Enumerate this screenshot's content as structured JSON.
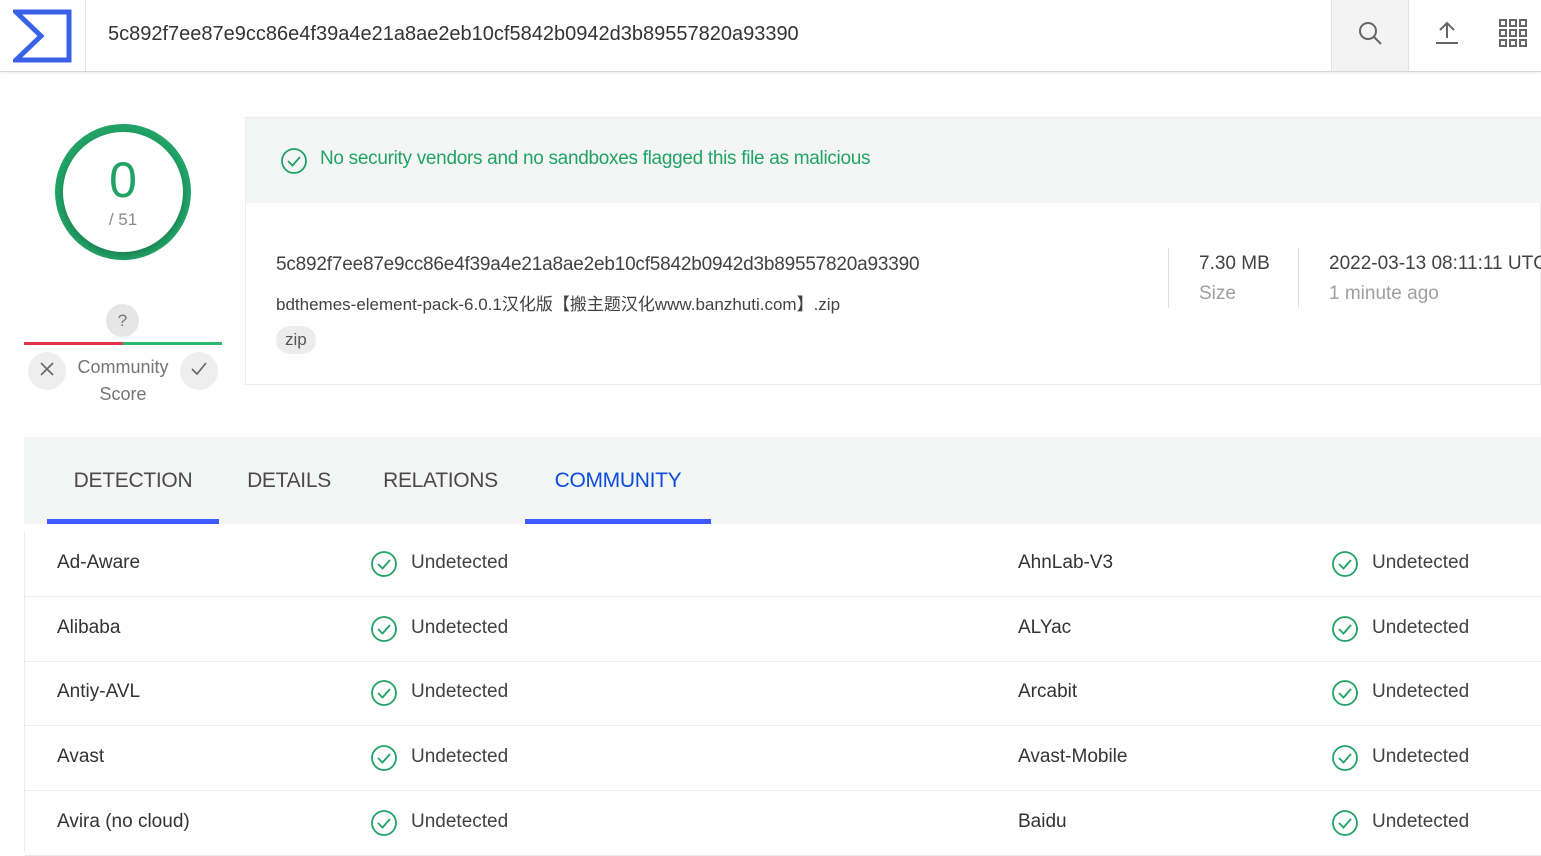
{
  "header": {
    "logo": "sigma-logo",
    "search_value": "5c892f7ee87e9cc86e4f39a4e21a8ae2eb10cf5842b0942d3b89557820a93390",
    "icons": [
      "search-icon",
      "upload-icon",
      "apps-grid-icon"
    ]
  },
  "score": {
    "detections": "0",
    "total": "/ 51",
    "ring_color": "#21a366"
  },
  "community": {
    "bubble": "?",
    "label": "Community Score",
    "colors": {
      "negative": "#e0334b",
      "positive": "#2bb673"
    }
  },
  "summary": {
    "verdict": "No security vendors and no sandboxes flagged this file as malicious",
    "hash": "5c892f7ee87e9cc86e4f39a4e21a8ae2eb10cf5842b0942d3b89557820a93390",
    "file_name": "bdthemes-element-pack-6.0.1汉化版【搬主题汉化www.banzhuti.com】.zip",
    "tag": "zip",
    "size_value": "7.30 MB",
    "size_label": "Size",
    "date_value": "2022-03-13 08:11:11 UTC",
    "date_label": "1 minute ago"
  },
  "tabs": [
    {
      "label": "DETECTION",
      "underline": true
    },
    {
      "label": "DETAILS",
      "underline": false
    },
    {
      "label": "RELATIONS",
      "underline": false
    },
    {
      "label": "COMMUNITY",
      "underline": true,
      "active": true
    }
  ],
  "results": [
    {
      "left": {
        "vendor": "Ad-Aware",
        "result": "Undetected"
      },
      "right": {
        "vendor": "AhnLab-V3",
        "result": "Undetected"
      }
    },
    {
      "left": {
        "vendor": "Alibaba",
        "result": "Undetected"
      },
      "right": {
        "vendor": "ALYac",
        "result": "Undetected"
      }
    },
    {
      "left": {
        "vendor": "Antiy-AVL",
        "result": "Undetected"
      },
      "right": {
        "vendor": "Arcabit",
        "result": "Undetected"
      }
    },
    {
      "left": {
        "vendor": "Avast",
        "result": "Undetected"
      },
      "right": {
        "vendor": "Avast-Mobile",
        "result": "Undetected"
      }
    },
    {
      "left": {
        "vendor": "Avira (no cloud)",
        "result": "Undetected"
      },
      "right": {
        "vendor": "Baidu",
        "result": "Undetected"
      }
    }
  ],
  "accent_colors": {
    "clean": "#21a366",
    "tab_active": "#0b4dda",
    "tab_underline": "#3d5afe"
  }
}
